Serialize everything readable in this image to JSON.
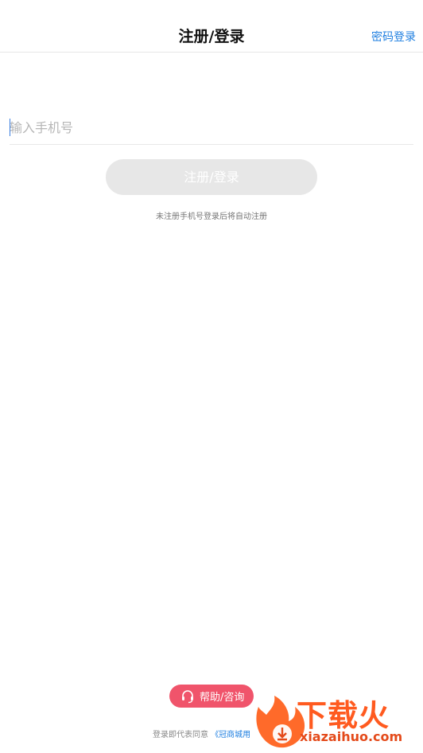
{
  "header": {
    "title": "注册/登录",
    "password_login": "密码登录"
  },
  "phone": {
    "placeholder": "输入手机号",
    "value": ""
  },
  "submit": {
    "label": "注册/登录"
  },
  "hint": "未注册手机号登录后将自动注册",
  "help": {
    "label": "帮助/咨询",
    "icon": "headset-icon"
  },
  "agreement": {
    "prefix": "登录即代表同意",
    "link": "《冠商城用"
  },
  "watermark": {
    "text": "下载火",
    "domain": "xiazaihuo.com"
  },
  "colors": {
    "accent": "#1f7fe0",
    "help_button": "#f0546b",
    "disabled_button": "#e7e7e7"
  }
}
